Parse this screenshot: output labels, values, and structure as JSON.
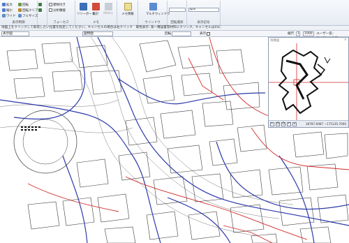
{
  "ribbon": {
    "small_buttons": [
      "拡大",
      "回転",
      "縮小",
      "回転クリア",
      "ワイド",
      "フルサイズ",
      "戻る",
      "進む"
    ],
    "group_view_title": "表示制御",
    "layer_label": "建物付き",
    "unit_label": "分析機能",
    "group_layer_title": "フォーカス",
    "big_buttons": [
      "ツリーボード",
      "集計",
      "Metrix",
      "メモ情報",
      "マルチウィンドウ"
    ],
    "group_meta_title": "メモ",
    "group_window_title": "ウインドウ",
    "group_rotate_title": "回転選択",
    "symbol_select": "標準",
    "group_display_title": "表示記号"
  },
  "status_line": "地図上をクリックして取得したい位置を指定してください。キャンセルの場合は右クリック　属性表示: 第一種設置管材料にクリック、キャンセルはESC",
  "toolbar2": {
    "scale_field": "表示図",
    "layer_field": "図物面",
    "rotate_label": "回転",
    "show_label": "表示",
    "scale_label": "縮尺",
    "scale_value": "1",
    "scale_denominator": "1000",
    "user_info": "ユーザー名：SNAP1(大倉寿)"
  },
  "overview": {
    "title": "鳥瞰図",
    "close": "×",
    "tools": [
      "↖",
      "Q",
      "Q",
      "↶",
      "⌂"
    ],
    "coordinates": "38787.6987  −175130.7000",
    "zoom": "1m"
  },
  "colors": {
    "road_blue": "#2b39a8",
    "road_red": "#d42a2a",
    "building": "#3a3a3a"
  }
}
